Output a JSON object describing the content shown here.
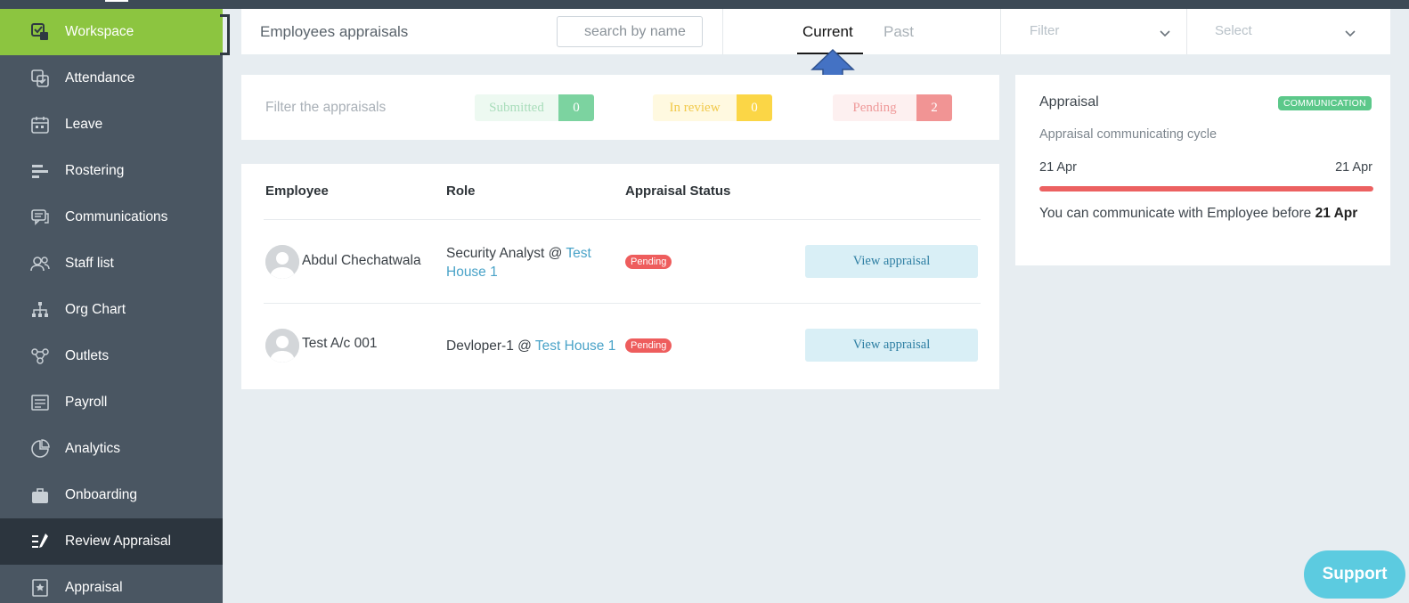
{
  "sidebar": {
    "items": [
      {
        "label": "Workspace",
        "icon": "workspace-icon"
      },
      {
        "label": "Attendance",
        "icon": "attendance-icon"
      },
      {
        "label": "Leave",
        "icon": "calendar-icon"
      },
      {
        "label": "Rostering",
        "icon": "rostering-icon"
      },
      {
        "label": "Communications",
        "icon": "chat-icon"
      },
      {
        "label": "Staff list",
        "icon": "staff-icon"
      },
      {
        "label": "Org Chart",
        "icon": "org-chart-icon"
      },
      {
        "label": "Outlets",
        "icon": "outlets-icon"
      },
      {
        "label": "Payroll",
        "icon": "payroll-icon"
      },
      {
        "label": "Analytics",
        "icon": "analytics-icon"
      },
      {
        "label": "Onboarding",
        "icon": "briefcase-icon"
      },
      {
        "label": "Review Appraisal",
        "icon": "review-icon"
      },
      {
        "label": "Appraisal",
        "icon": "appraisal-icon"
      }
    ]
  },
  "header": {
    "title": "Employees appraisals",
    "search_placeholder": "search by name",
    "tab_current": "Current",
    "tab_past": "Past",
    "filter_label": "Filter",
    "select_label": "Select"
  },
  "filters": {
    "title": "Filter the appraisals",
    "submitted": {
      "label": "Submitted",
      "count": "0"
    },
    "in_review": {
      "label": "In review",
      "count": "0"
    },
    "pending": {
      "label": "Pending",
      "count": "2"
    }
  },
  "table": {
    "headers": {
      "employee": "Employee",
      "role": "Role",
      "status": "Appraisal Status"
    },
    "rows": [
      {
        "name": "Abdul Chechatwala",
        "role": "Security Analyst @ ",
        "location": "Test House 1",
        "status": "Pending",
        "action": "View appraisal"
      },
      {
        "name": "Test A/c 001",
        "role": "Devloper-1 @ ",
        "location": "Test House 1",
        "status": "Pending",
        "action": "View appraisal"
      }
    ]
  },
  "appraisal": {
    "title": "Appraisal",
    "badge": "COMMUNICATION",
    "subtitle": "Appraisal communicating cycle",
    "start_date": "21 Apr",
    "end_date": "21 Apr",
    "progress": 1.0,
    "note_prefix": "You can communicate with Employee before ",
    "note_date": "21 Apr"
  },
  "support": {
    "label": "Support"
  },
  "colors": {
    "accent_green": "#8cc540",
    "sidebar_bg": "#4a5662",
    "pending_red": "#ee5d5d",
    "link_blue": "#4aa3c8"
  }
}
